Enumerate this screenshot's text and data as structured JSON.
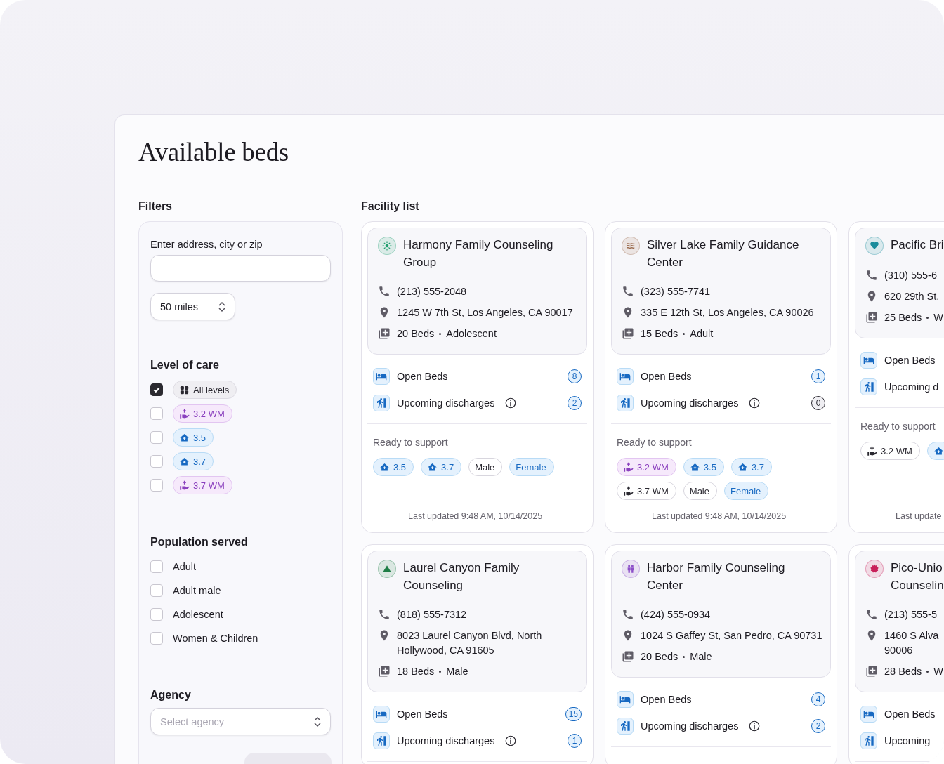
{
  "page": {
    "title": "Available beds"
  },
  "filters": {
    "heading": "Filters",
    "address_label": "Enter address, city or zip",
    "distance": "50 miles",
    "level_heading": "Level of care",
    "levels": [
      {
        "checked": true,
        "label": "All levels",
        "kind": "all",
        "highlighted": true
      },
      {
        "checked": false,
        "label": "3.2 WM",
        "kind": "wm",
        "highlighted": true
      },
      {
        "checked": false,
        "label": "3.5",
        "kind": "level",
        "highlighted": true
      },
      {
        "checked": false,
        "label": "3.7",
        "kind": "level",
        "highlighted": true
      },
      {
        "checked": false,
        "label": "3.7 WM",
        "kind": "wm",
        "highlighted": true
      }
    ],
    "population_heading": "Population served",
    "population": [
      {
        "label": "Adult",
        "checked": false
      },
      {
        "label": "Adult male",
        "checked": false
      },
      {
        "label": "Adolescent",
        "checked": false
      },
      {
        "label": "Women & Children",
        "checked": false
      }
    ],
    "agency_heading": "Agency",
    "agency_placeholder": "Select agency"
  },
  "facility_list": {
    "heading": "Facility list",
    "facilities": [
      {
        "name": "Harmony Family Counseling Group",
        "color": "#1f9e6e",
        "phone": "(213) 555-2048",
        "address": "1245 W 7th St, Los Angeles, CA 90017",
        "beds": "20 Beds",
        "population": "Adolescent",
        "stats": [
          {
            "kind": "open",
            "label": "Open Beds",
            "info": false,
            "count": "8",
            "highlighted": true
          },
          {
            "kind": "discharge",
            "label": "Upcoming discharges",
            "info": true,
            "count": "2",
            "highlighted": true
          }
        ],
        "ready_label": "Ready to support",
        "ready": [
          {
            "label": "3.5",
            "kind": "level",
            "highlighted": true
          },
          {
            "label": "3.7",
            "kind": "level",
            "highlighted": true
          },
          {
            "label": "Male",
            "kind": "population",
            "highlighted": false
          },
          {
            "label": "Female",
            "kind": "population",
            "highlighted": true
          }
        ],
        "updated": "Last updated 9:48 AM, 10/14/2025"
      },
      {
        "name": "Silver Lake Family Guidance Center",
        "color": "#9b6b4e",
        "phone": "(323) 555-7741",
        "address": "335 E 12th St, Los Angeles, CA 90026",
        "beds": "15 Beds",
        "population": "Adult",
        "stats": [
          {
            "kind": "open",
            "label": "Open Beds",
            "info": false,
            "count": "1",
            "highlighted": true
          },
          {
            "kind": "discharge",
            "label": "Upcoming discharges",
            "info": true,
            "count": "0",
            "highlighted": false
          }
        ],
        "ready_label": "Ready to support",
        "ready": [
          {
            "label": "3.2 WM",
            "kind": "wm",
            "highlighted": true
          },
          {
            "label": "3.5",
            "kind": "level",
            "highlighted": true
          },
          {
            "label": "3.7",
            "kind": "level",
            "highlighted": true
          },
          {
            "label": "3.7 WM",
            "kind": "wm",
            "highlighted": false
          },
          {
            "label": "Male",
            "kind": "population",
            "highlighted": false
          },
          {
            "label": "Female",
            "kind": "population",
            "highlighted": true
          }
        ],
        "updated": "Last updated 9:48 AM, 10/14/2025"
      },
      {
        "name": "Pacific Bri",
        "color": "#1a8c9c",
        "phone": "(310) 555-6",
        "address": "620 29th St,",
        "beds": "25 Beds",
        "population": "W",
        "stats": [
          {
            "kind": "open",
            "label": "Open Beds"
          },
          {
            "kind": "discharge",
            "label": "Upcoming d"
          }
        ],
        "ready_label": "Ready to support",
        "ready": [
          {
            "label": "3.2 WM",
            "kind": "wm",
            "highlighted": false
          },
          {
            "kind": "level",
            "highlighted": true
          }
        ],
        "updated": "Last update"
      },
      {
        "name": "Laurel Canyon Family Counseling",
        "color": "#1e7d45",
        "phone": "(818) 555-7312",
        "address": "8023 Laurel Canyon Blvd, North Hollywood, CA 91605",
        "beds": "18 Beds",
        "population": "Male",
        "stats": [
          {
            "kind": "open",
            "label": "Open Beds",
            "info": false,
            "count": "15",
            "highlighted": true
          },
          {
            "kind": "discharge",
            "label": "Upcoming discharges",
            "info": true,
            "count": "1",
            "highlighted": true
          }
        ]
      },
      {
        "name": "Harbor Family Counseling Center",
        "color": "#8d4fc9",
        "phone": "(424) 555-0934",
        "address": "1024 S Gaffey St, San Pedro, CA 90731",
        "beds": "20 Beds",
        "population": "Male",
        "stats": [
          {
            "kind": "open",
            "label": "Open Beds",
            "info": false,
            "count": "4",
            "highlighted": true
          },
          {
            "kind": "discharge",
            "label": "Upcoming discharges",
            "info": true,
            "count": "2",
            "highlighted": true
          }
        ]
      },
      {
        "name": "Pico-Unio\nCounselin",
        "color": "#c8205a",
        "phone": "(213) 555-5",
        "address": "1460 S Alva\n90006",
        "beds": "28 Beds",
        "population": "W",
        "stats": [
          {
            "kind": "open",
            "label": "Open Beds"
          },
          {
            "kind": "discharge",
            "label": "Upcoming"
          }
        ]
      }
    ]
  }
}
